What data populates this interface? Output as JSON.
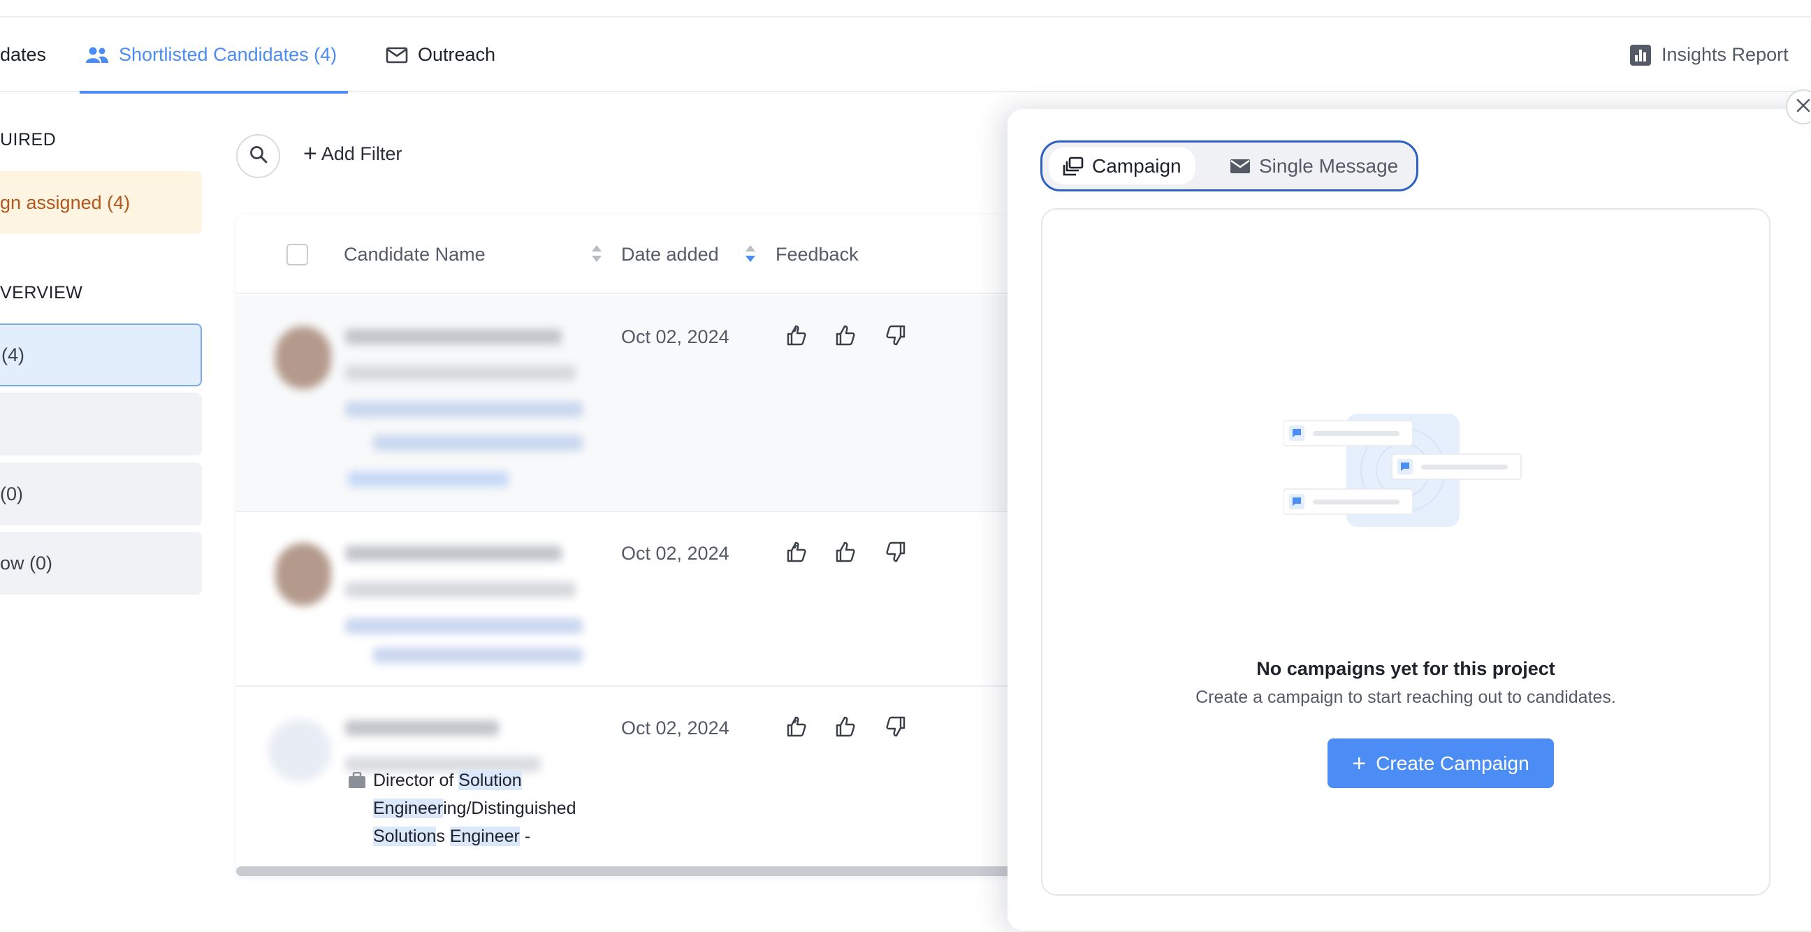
{
  "tabs": {
    "candidates": "dates",
    "shortlisted": "Shortlisted Candidates (4)",
    "outreach": "Outreach",
    "insights": "Insights Report"
  },
  "sidebar": {
    "required_title": "UIRED",
    "campaign_assigned": "gn assigned (4)",
    "overview_title": "VERVIEW",
    "items": [
      {
        "label": "(4)",
        "state": "active"
      },
      {
        "label": "",
        "state": "default"
      },
      {
        "label": "(0)",
        "state": "default"
      },
      {
        "label": "ow (0)",
        "state": "default"
      }
    ]
  },
  "filter": {
    "add_filter": "Add Filter"
  },
  "table": {
    "columns": {
      "name": "Candidate Name",
      "date": "Date added",
      "feedback": "Feedback"
    },
    "rows": [
      {
        "date": "Oct 02, 2024"
      },
      {
        "date": "Oct 02, 2024"
      },
      {
        "date": "Oct 02, 2024",
        "job_parts": [
          "Director of ",
          "Solution",
          " ",
          "Engineer",
          "ing/Distinguished ",
          "Solution",
          "s ",
          "Engineer",
          " -"
        ]
      }
    ]
  },
  "outreach_panel": {
    "mode_campaign": "Campaign",
    "mode_single": "Single Message",
    "empty_title": "No campaigns yet for this project",
    "empty_subtitle": "Create a campaign to start reaching out to candidates.",
    "create_button": "Create Campaign"
  },
  "colors": {
    "accent": "#4c8df5",
    "segment_border": "#2d5fc4",
    "warning_bg": "#fdf5e2",
    "warning_text": "#b4571c",
    "highlight": "#dbe8fb"
  },
  "icons": [
    "people-icon",
    "mail-icon",
    "chart-icon",
    "search-icon",
    "plus-icon",
    "sort-icon",
    "thumbs-up-icon",
    "thumbs-down-icon",
    "briefcase-icon",
    "close-icon",
    "campaign-icon",
    "message-bubble-icon"
  ]
}
